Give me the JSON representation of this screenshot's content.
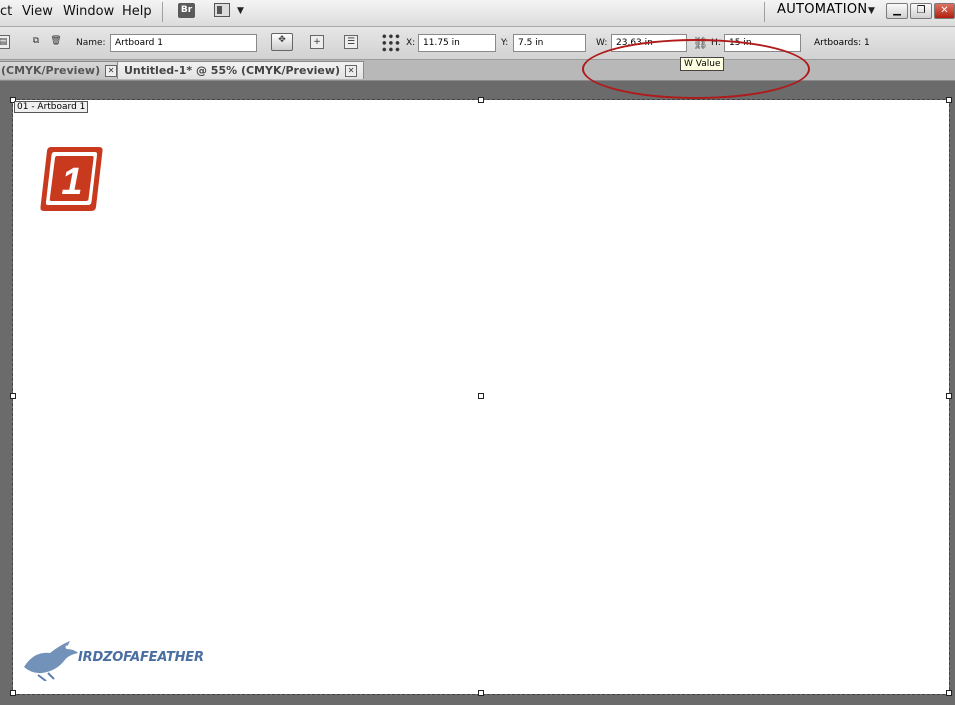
{
  "menu": {
    "items": [
      "ct",
      "View",
      "Window",
      "Help"
    ],
    "bridge_label": "Br",
    "workspace_label": "AUTOMATION"
  },
  "window_controls": [
    "minimize-icon",
    "restore-icon",
    "close-icon"
  ],
  "control_bar": {
    "name_label": "Name:",
    "name_value": "Artboard 1",
    "x_label": "X:",
    "x_value": "11.75 in",
    "y_label": "Y:",
    "y_value": "7.5 in",
    "w_label": "W:",
    "w_value": "23.63 in",
    "h_label": "H:",
    "h_value": "15 in",
    "artboards_label": "Artboards: 1",
    "tooltip": "W Value"
  },
  "tabs": [
    {
      "label": "(CMYK/Preview)",
      "active": false
    },
    {
      "label": "Untitled-1* @ 55% (CMYK/Preview)",
      "active": true
    }
  ],
  "artboard": {
    "label": "01 - Artboard 1",
    "badge_number": "1"
  },
  "watermark": {
    "text": "IRDZOFAFEATHER"
  },
  "colors": {
    "highlight": "#b01a1a",
    "badge": "#c8391e",
    "watermark": "#4a6fa0"
  }
}
